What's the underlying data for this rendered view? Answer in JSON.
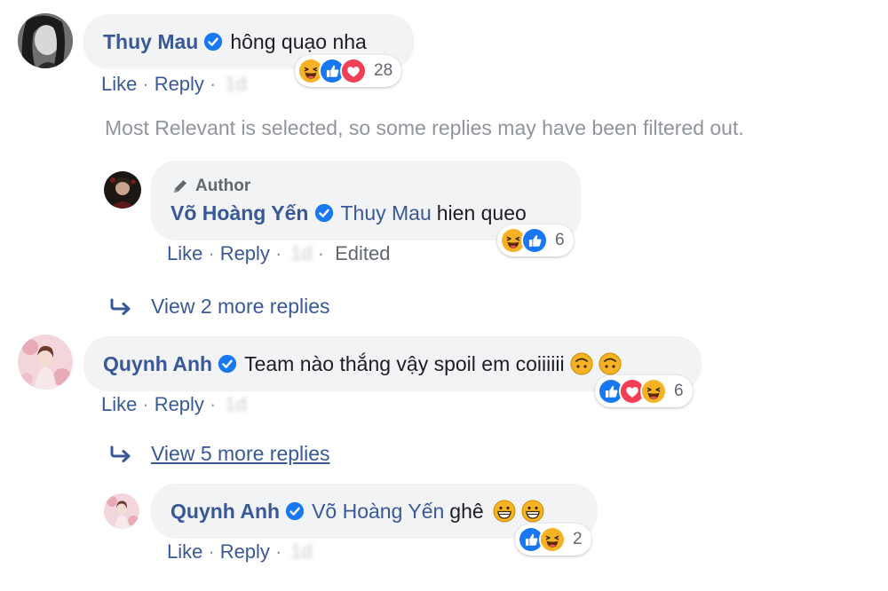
{
  "comments": [
    {
      "author": "Thuy Mau",
      "text": "hông quạo nha",
      "actions": {
        "like": "Like",
        "reply": "Reply",
        "time": "1d"
      },
      "reactions": {
        "icons": [
          "haha-icon",
          "like-icon",
          "love-icon"
        ],
        "count": "28"
      }
    },
    {
      "author": "Quynh Anh",
      "text": "Team nào thắng vậy spoil em coiiiiii",
      "actions": {
        "like": "Like",
        "reply": "Reply",
        "time": "1d"
      },
      "reactions": {
        "icons": [
          "like-icon",
          "love-icon",
          "haha-icon"
        ],
        "count": "6"
      }
    }
  ],
  "notice": "Most Relevant is selected, so some replies may have been filtered out.",
  "replies": [
    {
      "badge": "Author",
      "author": "Võ Hoàng Yến",
      "mention": "Thuy Mau",
      "text": "hien queo",
      "actions": {
        "like": "Like",
        "reply": "Reply",
        "time": "1d",
        "edited": "Edited"
      },
      "reactions": {
        "icons": [
          "haha-icon",
          "like-icon"
        ],
        "count": "6"
      }
    },
    {
      "author": "Quynh Anh",
      "mention": "Võ Hoàng Yến",
      "text": "ghê",
      "actions": {
        "like": "Like",
        "reply": "Reply",
        "time": "1d"
      },
      "reactions": {
        "icons": [
          "like-icon",
          "haha-icon"
        ],
        "count": "2"
      }
    }
  ],
  "view_more": [
    {
      "label": "View 2 more replies"
    },
    {
      "label": "View 5 more replies"
    }
  ],
  "separators": {
    "dot": "·"
  },
  "colors": {
    "link": "#385898",
    "bubble": "#f2f3f5",
    "muted": "#90949c",
    "verified": "#1877f2",
    "love": "#f33e58",
    "haha": "#f7b125"
  }
}
